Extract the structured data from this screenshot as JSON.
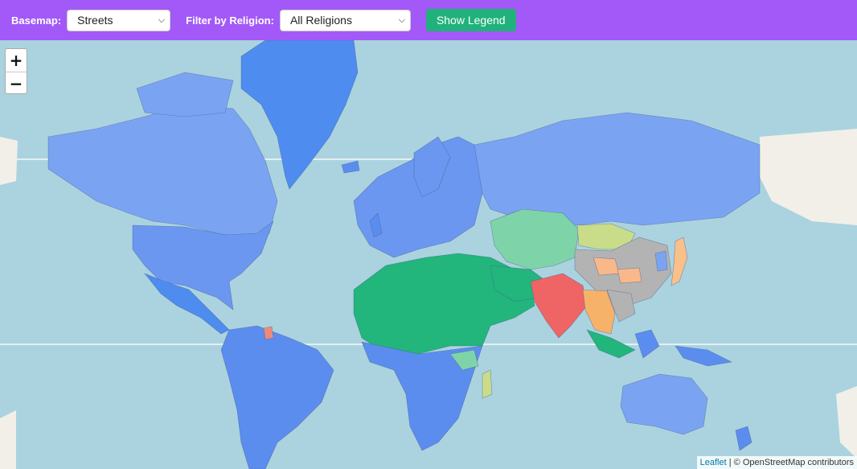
{
  "controls": {
    "basemap_label": "Basemap:",
    "basemap_value": "Streets",
    "religion_label": "Filter by Religion:",
    "religion_value": "All Religions",
    "legend_button": "Show Legend"
  },
  "zoom": {
    "in": "+",
    "out": "−"
  },
  "attribution": {
    "link": "Leaflet",
    "separator": "|",
    "text": "© OpenStreetMap contributors"
  },
  "colors": {
    "water": "#aad3df",
    "christian": "#5b8def",
    "christian_light": "#7aa4f2",
    "islam": "#22b57c",
    "islam_light": "#7fd3a8",
    "hindu": "#ef6464",
    "buddhist": "#f7b26a",
    "chinese_folk": "#b3b3b3",
    "folk": "#c8dc8a",
    "shinto": "#f9c08a"
  }
}
